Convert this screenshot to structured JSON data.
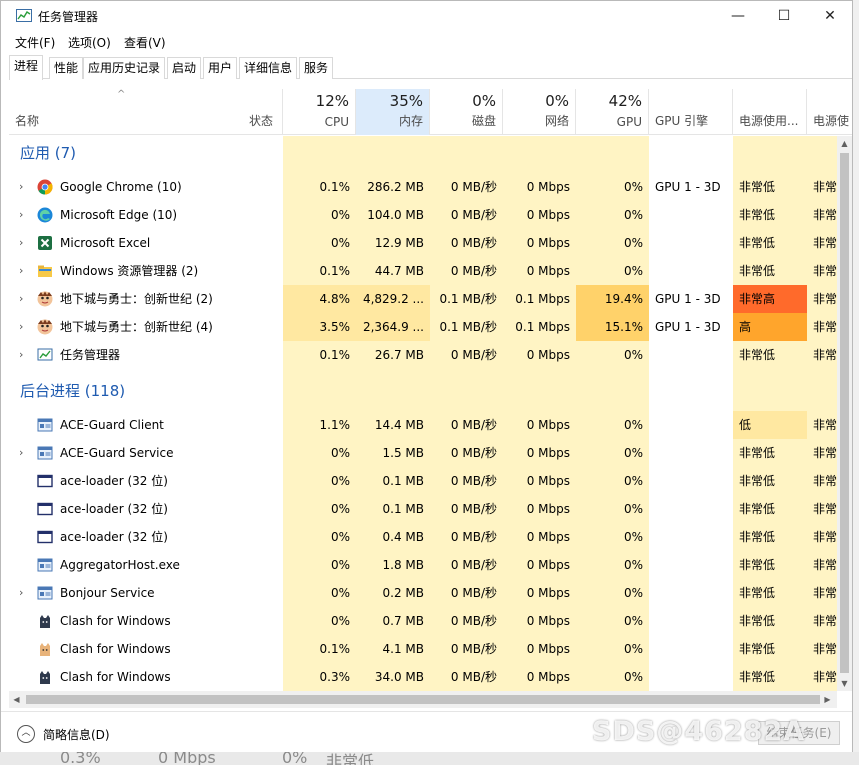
{
  "window": {
    "title": "任务管理器",
    "minimize_glyph": "—",
    "maximize_glyph": "☐",
    "close_glyph": "✕"
  },
  "menu": [
    "文件(F)",
    "选项(O)",
    "查看(V)"
  ],
  "tabs": [
    "进程",
    "性能",
    "应用历史记录",
    "启动",
    "用户",
    "详细信息",
    "服务"
  ],
  "active_tab": "进程",
  "columns": {
    "name": "名称",
    "status": "状态",
    "cpu": {
      "percent": "12%",
      "label": "CPU"
    },
    "memory": {
      "percent": "35%",
      "label": "内存"
    },
    "disk": {
      "percent": "0%",
      "label": "磁盘"
    },
    "network": {
      "percent": "0%",
      "label": "网络"
    },
    "gpu": {
      "percent": "42%",
      "label": "GPU"
    },
    "gpu_engine": "GPU 引擎",
    "power": "电源使用...",
    "power_trend": "电源使"
  },
  "groups": {
    "apps": {
      "title": "应用 (7)",
      "rows": [
        {
          "icon": "chrome-icon",
          "expandable": true,
          "name": "Google Chrome (10)",
          "cpu": "0.1%",
          "mem": "286.2 MB",
          "disk": "0 MB/秒",
          "net": "0 Mbps",
          "gpu": "0%",
          "engine": "GPU 1 - 3D",
          "power": "非常低",
          "trend": "非常"
        },
        {
          "icon": "edge-icon",
          "expandable": true,
          "name": "Microsoft Edge (10)",
          "cpu": "0%",
          "mem": "104.0 MB",
          "disk": "0 MB/秒",
          "net": "0 Mbps",
          "gpu": "0%",
          "engine": "",
          "power": "非常低",
          "trend": "非常"
        },
        {
          "icon": "excel-icon",
          "expandable": true,
          "name": "Microsoft Excel",
          "cpu": "0%",
          "mem": "12.9 MB",
          "disk": "0 MB/秒",
          "net": "0 Mbps",
          "gpu": "0%",
          "engine": "",
          "power": "非常低",
          "trend": "非常"
        },
        {
          "icon": "folder-icon",
          "expandable": true,
          "name": "Windows 资源管理器 (2)",
          "cpu": "0.1%",
          "mem": "44.7 MB",
          "disk": "0 MB/秒",
          "net": "0 Mbps",
          "gpu": "0%",
          "engine": "",
          "power": "非常低",
          "trend": "非常"
        },
        {
          "icon": "game-icon",
          "expandable": true,
          "name": "地下城与勇士：创新世纪 (2)",
          "cpu": "4.8%",
          "mem": "4,829.2 ...",
          "disk": "0.1 MB/秒",
          "net": "0.1 Mbps",
          "gpu": "19.4%",
          "engine": "GPU 1 - 3D",
          "power": "非常高",
          "trend": "非常"
        },
        {
          "icon": "game-icon",
          "expandable": true,
          "name": "地下城与勇士：创新世纪 (4)",
          "cpu": "3.5%",
          "mem": "2,364.9 ...",
          "disk": "0.1 MB/秒",
          "net": "0.1 Mbps",
          "gpu": "15.1%",
          "engine": "GPU 1 - 3D",
          "power": "高",
          "trend": "非常"
        },
        {
          "icon": "taskmgr-icon",
          "expandable": true,
          "name": "任务管理器",
          "cpu": "0.1%",
          "mem": "26.7 MB",
          "disk": "0 MB/秒",
          "net": "0 Mbps",
          "gpu": "0%",
          "engine": "",
          "power": "非常低",
          "trend": "非常"
        }
      ]
    },
    "background": {
      "title": "后台进程 (118)",
      "rows": [
        {
          "icon": "service-icon",
          "expandable": false,
          "name": "ACE-Guard Client",
          "cpu": "1.1%",
          "mem": "14.4 MB",
          "disk": "0 MB/秒",
          "net": "0 Mbps",
          "gpu": "0%",
          "engine": "",
          "power": "低",
          "trend": "非常"
        },
        {
          "icon": "service-icon",
          "expandable": true,
          "name": "ACE-Guard Service",
          "cpu": "0%",
          "mem": "1.5 MB",
          "disk": "0 MB/秒",
          "net": "0 Mbps",
          "gpu": "0%",
          "engine": "",
          "power": "非常低",
          "trend": "非常"
        },
        {
          "icon": "window-icon",
          "expandable": false,
          "name": "ace-loader (32 位)",
          "cpu": "0%",
          "mem": "0.1 MB",
          "disk": "0 MB/秒",
          "net": "0 Mbps",
          "gpu": "0%",
          "engine": "",
          "power": "非常低",
          "trend": "非常"
        },
        {
          "icon": "window-icon",
          "expandable": false,
          "name": "ace-loader (32 位)",
          "cpu": "0%",
          "mem": "0.1 MB",
          "disk": "0 MB/秒",
          "net": "0 Mbps",
          "gpu": "0%",
          "engine": "",
          "power": "非常低",
          "trend": "非常"
        },
        {
          "icon": "window-icon",
          "expandable": false,
          "name": "ace-loader (32 位)",
          "cpu": "0%",
          "mem": "0.4 MB",
          "disk": "0 MB/秒",
          "net": "0 Mbps",
          "gpu": "0%",
          "engine": "",
          "power": "非常低",
          "trend": "非常"
        },
        {
          "icon": "service-icon",
          "expandable": false,
          "name": "AggregatorHost.exe",
          "cpu": "0%",
          "mem": "1.8 MB",
          "disk": "0 MB/秒",
          "net": "0 Mbps",
          "gpu": "0%",
          "engine": "",
          "power": "非常低",
          "trend": "非常"
        },
        {
          "icon": "service-icon",
          "expandable": true,
          "name": "Bonjour Service",
          "cpu": "0%",
          "mem": "0.2 MB",
          "disk": "0 MB/秒",
          "net": "0 Mbps",
          "gpu": "0%",
          "engine": "",
          "power": "非常低",
          "trend": "非常"
        },
        {
          "icon": "cat-icon",
          "expandable": false,
          "name": "Clash for Windows",
          "cpu": "0%",
          "mem": "0.7 MB",
          "disk": "0 MB/秒",
          "net": "0 Mbps",
          "gpu": "0%",
          "engine": "",
          "power": "非常低",
          "trend": "非常"
        },
        {
          "icon": "cat-light-icon",
          "expandable": false,
          "name": "Clash for Windows",
          "cpu": "0.1%",
          "mem": "4.1 MB",
          "disk": "0 MB/秒",
          "net": "0 Mbps",
          "gpu": "0%",
          "engine": "",
          "power": "非常低",
          "trend": "非常"
        },
        {
          "icon": "cat-icon",
          "expandable": false,
          "name": "Clash for Windows",
          "cpu": "0.3%",
          "mem": "34.0 MB",
          "disk": "0 MB/秒",
          "net": "0 Mbps",
          "gpu": "0%",
          "engine": "",
          "power": "非常低",
          "trend": "非常"
        }
      ]
    }
  },
  "footer": {
    "fewer_details": "简略信息(D)",
    "end_task": "结束任务(E)"
  },
  "background_strip": {
    "cpu": "0.3%",
    "net": "0 Mbps",
    "gpu": "0%",
    "power": "非常低"
  },
  "watermark": "SDS@46282A",
  "colors": {
    "heat_light": "#fff4c4",
    "heat_medium": "#ffe8a1",
    "heat_strong": "#ffd26a",
    "power_very_high": "#ff6a2b",
    "power_high": "#ffa52c",
    "group_title": "#1f5bb0",
    "memory_header": "#dcebfb"
  }
}
